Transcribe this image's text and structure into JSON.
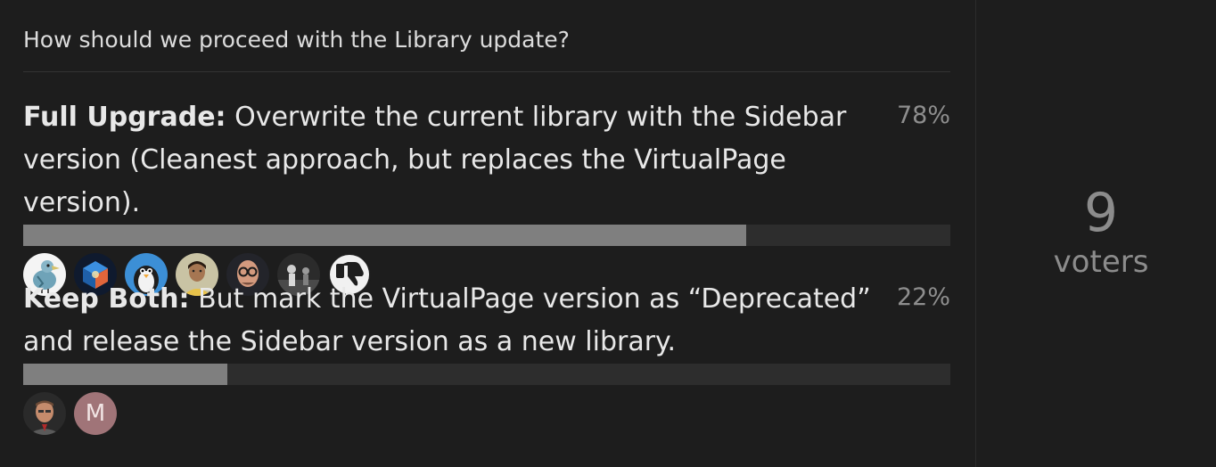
{
  "poll": {
    "question": "How should we proceed with the Library update?",
    "options": [
      {
        "title": "Full Upgrade:",
        "description": "Overwrite the current library with the Sidebar version (Cleanest approach, but replaces the VirtualPage version).",
        "percent_label": "78%",
        "percent": 78,
        "voters": [
          "dodo-avatar",
          "cube-avatar",
          "penguin-avatar",
          "person-avatar",
          "glasses-avatar",
          "bw-photo-avatar",
          "thumbs-down-avatar"
        ]
      },
      {
        "title": "Keep Both:",
        "description": "But mark the VirtualPage version as “Deprecated” and release the Sidebar version as a new library.",
        "percent_label": "22%",
        "percent": 22,
        "voters": [
          "man-avatar",
          "letter-avatar"
        ],
        "letter_avatar": "M"
      }
    ],
    "voter_count": "9",
    "voter_count_label": "voters"
  },
  "colors": {
    "background": "#1d1d1d",
    "bar_track": "#2d2d2d",
    "bar_fill": "#7f7f7f",
    "muted_text": "#8c8c8c",
    "letter_avatar_bg": "#a07478"
  }
}
